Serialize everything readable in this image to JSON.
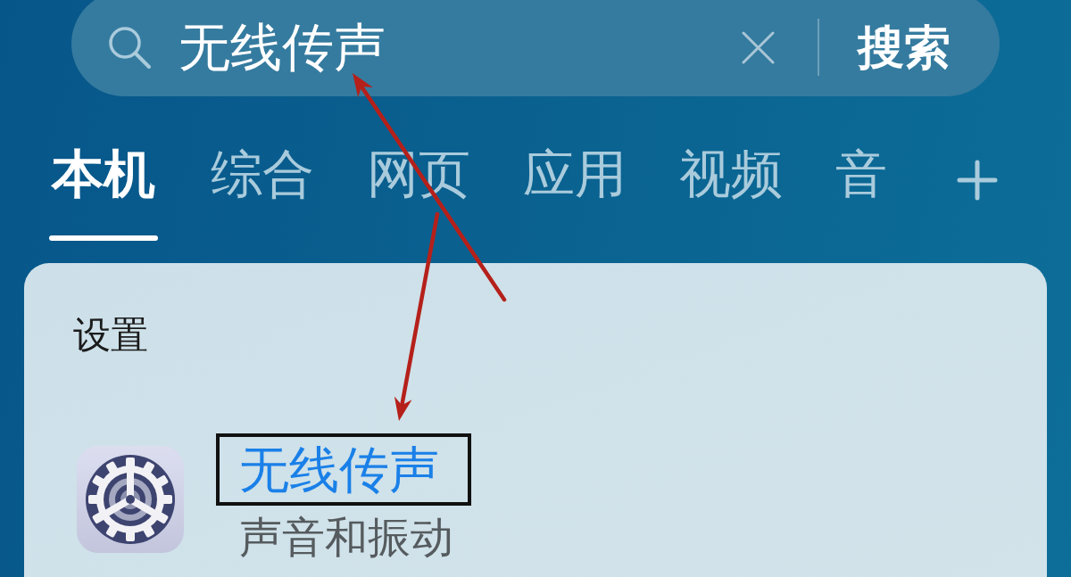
{
  "search": {
    "value": "无线传声",
    "button": "搜索"
  },
  "tabs": [
    {
      "label": "本机",
      "selected": true
    },
    {
      "label": "综合",
      "selected": false
    },
    {
      "label": "网页",
      "selected": false
    },
    {
      "label": "应用",
      "selected": false
    },
    {
      "label": "视频",
      "selected": false
    },
    {
      "label": "音",
      "selected": false
    }
  ],
  "results": {
    "section": "设置",
    "items": [
      {
        "title": "无线传声",
        "subtitle": "声音和振动",
        "highlighted": true
      }
    ]
  }
}
